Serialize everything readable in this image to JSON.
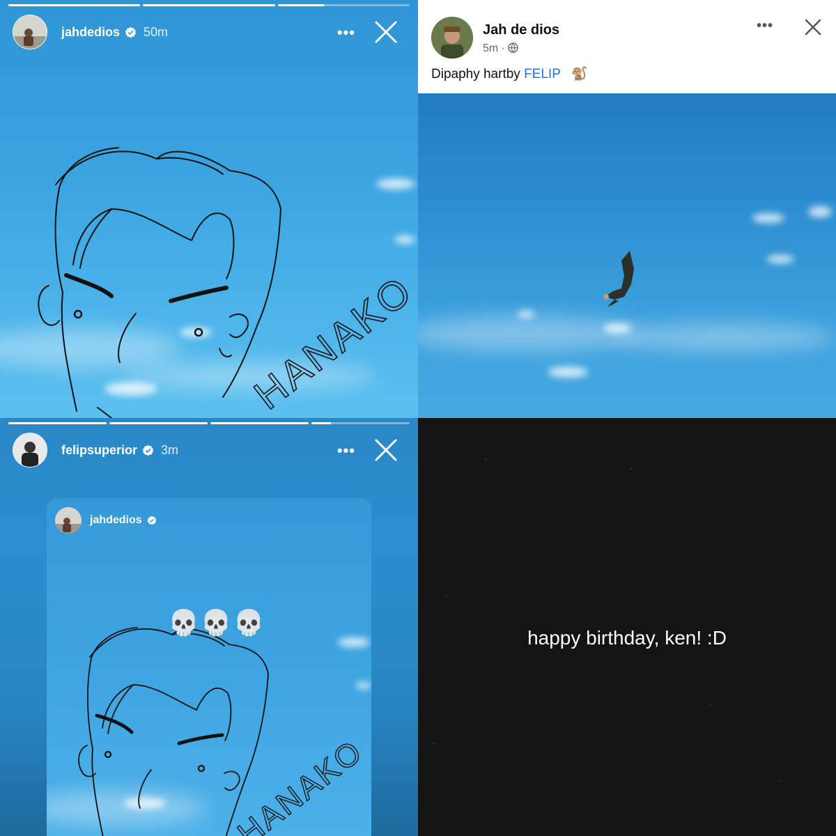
{
  "panel1": {
    "username": "jahdedios",
    "time": "50m",
    "doodle_text": "HANAKO",
    "progress": [
      1,
      1,
      0.35
    ]
  },
  "panel2": {
    "name": "Jah de dios",
    "time": "5m",
    "caption": "Dipaphy hartby ",
    "tag": "FELIP",
    "emoji": "🐒"
  },
  "panel3": {
    "username": "felipsuperior",
    "time": "3m",
    "progress": [
      1,
      1,
      1,
      0.2
    ],
    "reshared_user": "jahdedios",
    "skulls": "💀💀💀",
    "doodle_text": "HANAKO"
  },
  "panel4": {
    "message": "happy birthday, ken! :D"
  },
  "colors": {
    "sky": "#3aa3e0",
    "link": "#1877f2",
    "black_bg": "#141414"
  },
  "icons": [
    "verified-badge-icon",
    "more-icon",
    "close-icon",
    "globe-icon"
  ]
}
